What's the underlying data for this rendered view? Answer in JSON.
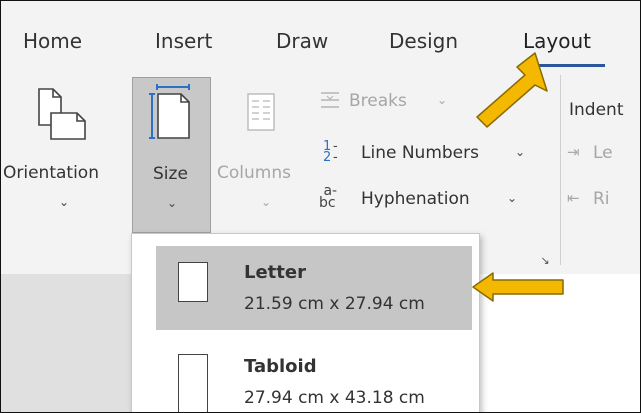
{
  "tabs": [
    {
      "label": "Home"
    },
    {
      "label": "Insert"
    },
    {
      "label": "Draw"
    },
    {
      "label": "Design"
    },
    {
      "label": "Layout"
    }
  ],
  "ribbon": {
    "orientation": "Orientation",
    "size": "Size",
    "columns": "Columns",
    "breaks": "Breaks",
    "line_numbers": "Line Numbers",
    "hyphenation": "Hyphenation",
    "indent": "Indent",
    "indent_left": "Le",
    "indent_right": "Ri"
  },
  "size_menu": {
    "items": [
      {
        "name": "Letter",
        "dims": "21.59 cm x 27.94 cm",
        "selected": true
      },
      {
        "name": "Tabloid",
        "dims": "27.94 cm x 43.18 cm",
        "selected": false
      }
    ]
  },
  "colors": {
    "accent": "#2b579a",
    "arrow": "#f5b800",
    "selected_bg": "#c6c6c6"
  },
  "icons": [
    "orientation-icon",
    "size-icon",
    "columns-icon",
    "breaks-icon",
    "line-numbers-icon",
    "hyphenation-icon",
    "indent-left-icon",
    "indent-right-icon",
    "dialog-launcher-icon",
    "chevron-down-icon",
    "paper-icon"
  ]
}
